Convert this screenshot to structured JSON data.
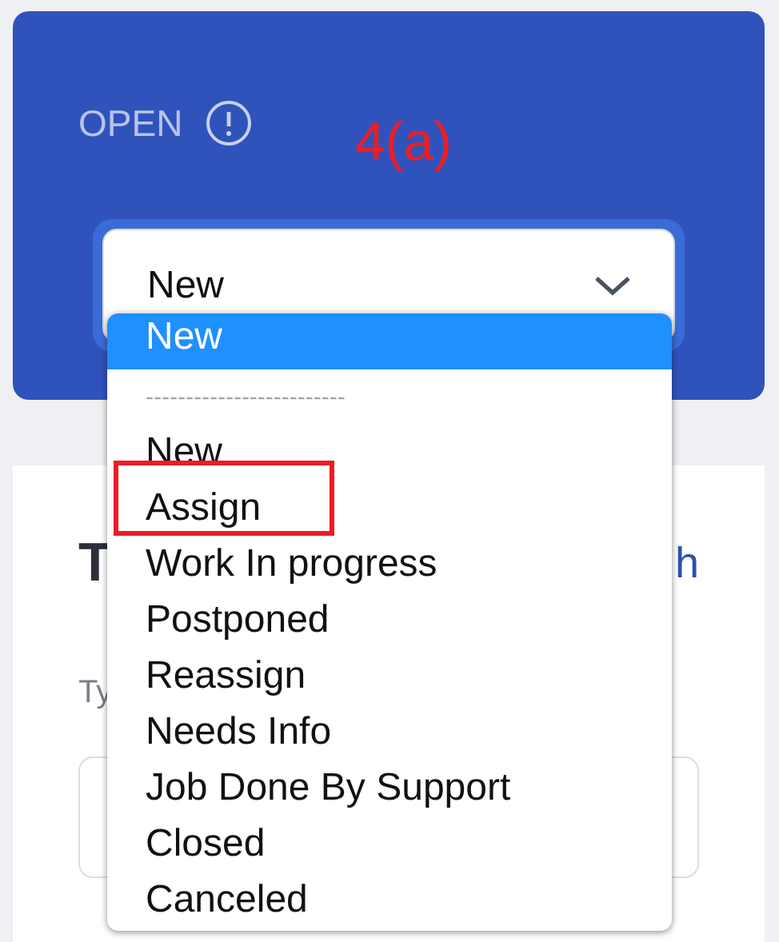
{
  "panel": {
    "label": "OPEN",
    "annotation": "4(a)",
    "select": {
      "value": "New",
      "expanded": true
    }
  },
  "dropdown": {
    "options": [
      {
        "kind": "option",
        "label": "New",
        "selected": true,
        "highlighted": false
      },
      {
        "kind": "separator",
        "label": "-------------------------"
      },
      {
        "kind": "option",
        "label": "New",
        "selected": false,
        "highlighted": false
      },
      {
        "kind": "option",
        "label": "Assign",
        "selected": false,
        "highlighted": true
      },
      {
        "kind": "option",
        "label": "Work In progress",
        "selected": false,
        "highlighted": false
      },
      {
        "kind": "option",
        "label": "Postponed",
        "selected": false,
        "highlighted": false
      },
      {
        "kind": "option",
        "label": "Reassign",
        "selected": false,
        "highlighted": false
      },
      {
        "kind": "option",
        "label": "Needs Info",
        "selected": false,
        "highlighted": false
      },
      {
        "kind": "option",
        "label": "Job Done By Support",
        "selected": false,
        "highlighted": false
      },
      {
        "kind": "option",
        "label": "Closed",
        "selected": false,
        "highlighted": false
      },
      {
        "kind": "option",
        "label": "Canceled",
        "selected": false,
        "highlighted": false
      }
    ]
  },
  "background": {
    "heading": "T",
    "link": "h",
    "field_label": "Ty"
  }
}
